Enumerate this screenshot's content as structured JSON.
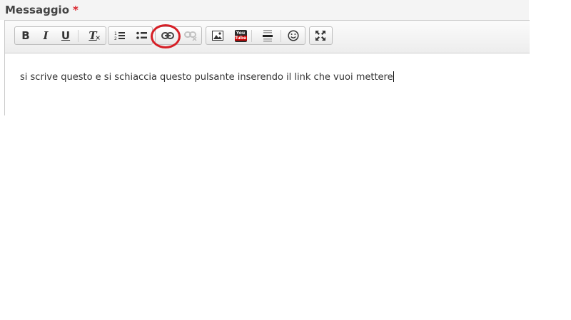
{
  "field": {
    "label": "Messaggio",
    "required_marker": "*"
  },
  "toolbar": {
    "buttons": [
      {
        "name": "bold",
        "glyph": "B"
      },
      {
        "name": "italic",
        "glyph": "I"
      },
      {
        "name": "underline",
        "glyph": "U"
      },
      {
        "name": "remove-format",
        "glyph": "T"
      },
      {
        "name": "numbered-list",
        "icon": "numbered-list-icon"
      },
      {
        "name": "bulleted-list",
        "icon": "bulleted-list-icon"
      },
      {
        "name": "link",
        "icon": "link-icon"
      },
      {
        "name": "unlink",
        "icon": "unlink-icon",
        "disabled": true
      },
      {
        "name": "image",
        "icon": "image-icon"
      },
      {
        "name": "youtube",
        "icon": "youtube-icon",
        "glyph": "You Tube"
      },
      {
        "name": "horizontal-line",
        "icon": "horizontal-line-icon"
      },
      {
        "name": "smiley",
        "icon": "smiley-icon"
      },
      {
        "name": "maximize",
        "icon": "maximize-icon"
      }
    ]
  },
  "editor": {
    "content": "si scrive questo e si schiaccia questo pulsante inserendo il link che vuoi mettere"
  },
  "colors": {
    "annotation_circle": "#d61f26",
    "required_star": "#d9232a"
  }
}
